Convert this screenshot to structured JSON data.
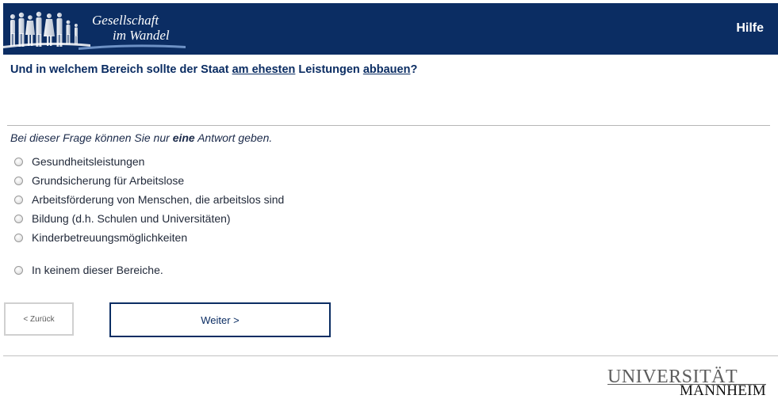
{
  "header": {
    "logo_line1": "Gesellschaft",
    "logo_line2": "im Wandel",
    "help_label": "Hilfe",
    "background_color": "#0b2d63"
  },
  "question": {
    "part1": "Und in welchem Bereich sollte der Staat ",
    "emph1": "am ehesten",
    "part2": " Leistungen ",
    "emph2": "abbauen",
    "part3": "?"
  },
  "instruction": {
    "part1": "Bei dieser Frage können Sie nur ",
    "emph": "eine",
    "part2": " Antwort geben."
  },
  "options": [
    {
      "label": "Gesundheitsleistungen",
      "selected": false
    },
    {
      "label": "Grundsicherung für Arbeitslose",
      "selected": false
    },
    {
      "label": "Arbeitsförderung von Menschen, die arbeitslos sind",
      "selected": false
    },
    {
      "label": "Bildung (d.h. Schulen und Universitäten)",
      "selected": false
    },
    {
      "label": "Kinderbetreuungsmöglichkeiten",
      "selected": false
    },
    {
      "label": "In keinem dieser Bereiche.",
      "selected": false
    }
  ],
  "nav": {
    "back_label": "< Zurück",
    "next_label": "Weiter >"
  },
  "footer": {
    "university_line1": "UNIVERSITÄT",
    "university_line2": "MANNHEIM"
  }
}
